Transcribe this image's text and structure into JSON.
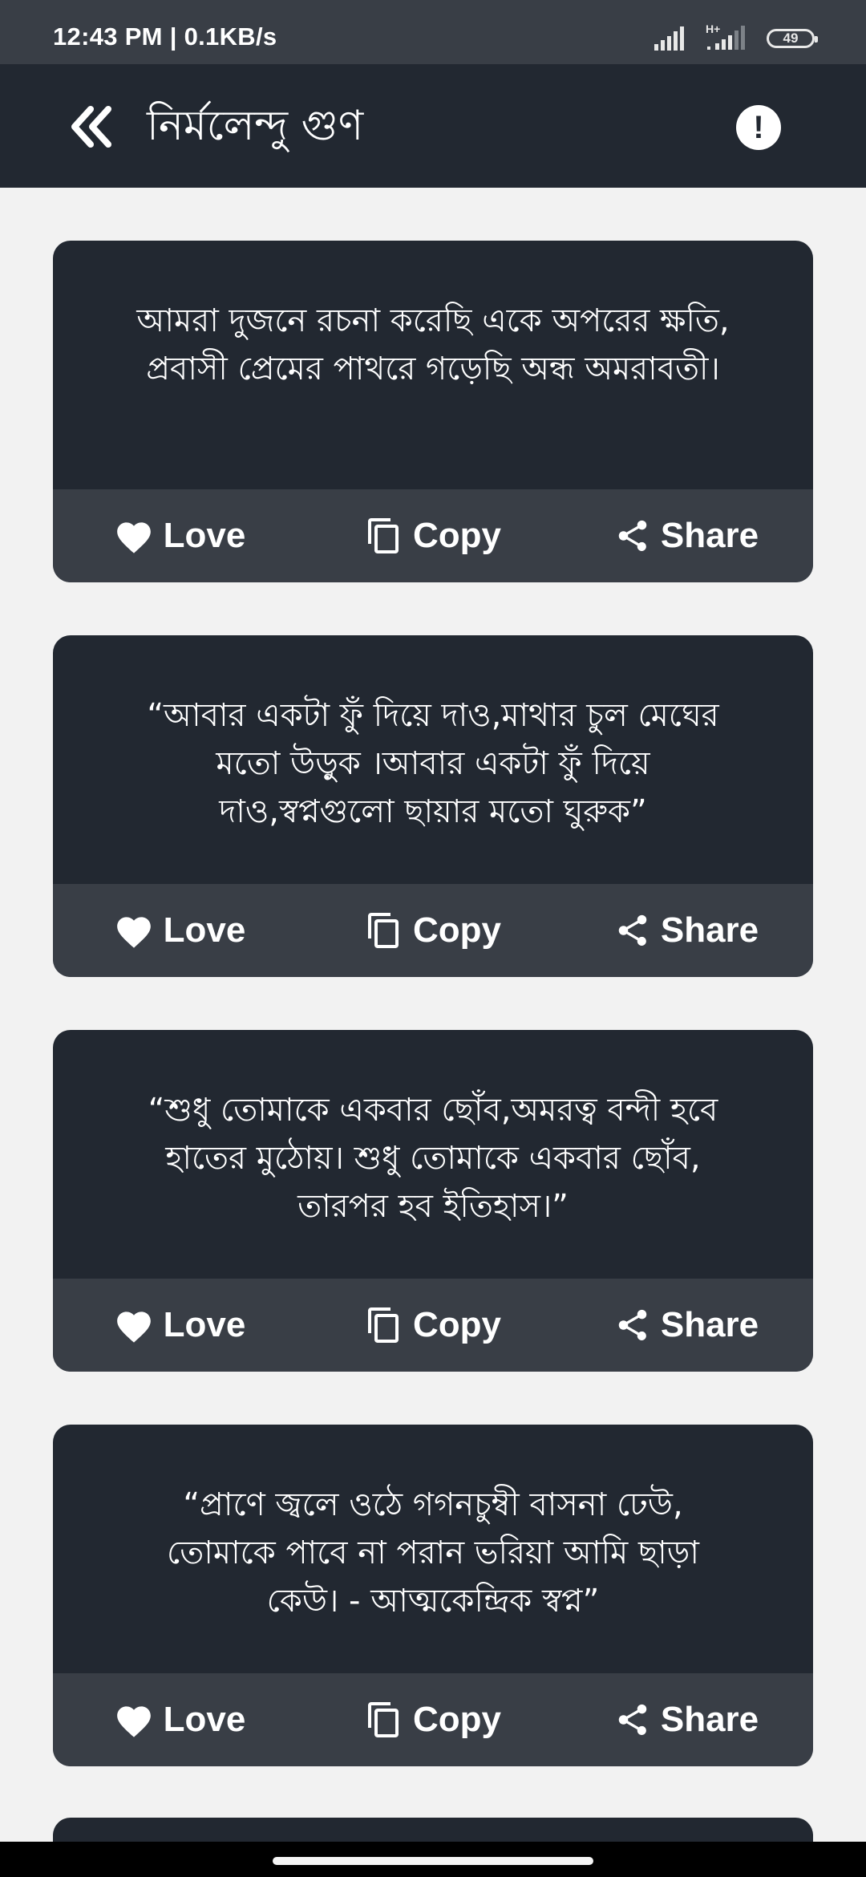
{
  "status_bar": {
    "time_speed": "12:43 PM | 0.1KB/s",
    "network": "H+",
    "battery": "49"
  },
  "header": {
    "title": "নির্মলেন্দু গুণ"
  },
  "actions": {
    "love": "Love",
    "copy": "Copy",
    "share": "Share"
  },
  "quotes": [
    {
      "text": "আমরা দুজনে রচনা করেছি একে অপরের ক্ষতি, প্রবাসী প্রেমের পাথরে গড়েছি  অন্ধ অমরাবতী।"
    },
    {
      "text": "“আবার একটা ফুঁ দিয়ে দাও,মাথার চুল মেঘের মতো উড়ুক ।আবার একটা ফুঁ দিয়ে দাও,স্বপ্নগুলো ছায়ার মতো ঘুরুক”"
    },
    {
      "text": "“শুধু তোমাকে একবার ছোঁব,অমরত্ব বন্দী হবে হাতের মুঠোয়। শুধু তোমাকে একবার ছোঁব, তারপর হব ইতিহাস।”"
    },
    {
      "text": "“প্রাণে জ্বলে ওঠে গগনচুম্বী বাসনা ঢেউ, তোমাকে পাবে না পরান ভরিয়া আমি ছাড়া কেউ।  - আত্মকেন্দ্রিক স্বপ্ন”"
    }
  ],
  "colors": {
    "app_bar": "#222831",
    "card_body": "#222831",
    "card_actions": "#393e46",
    "background": "#f2f2f2"
  }
}
